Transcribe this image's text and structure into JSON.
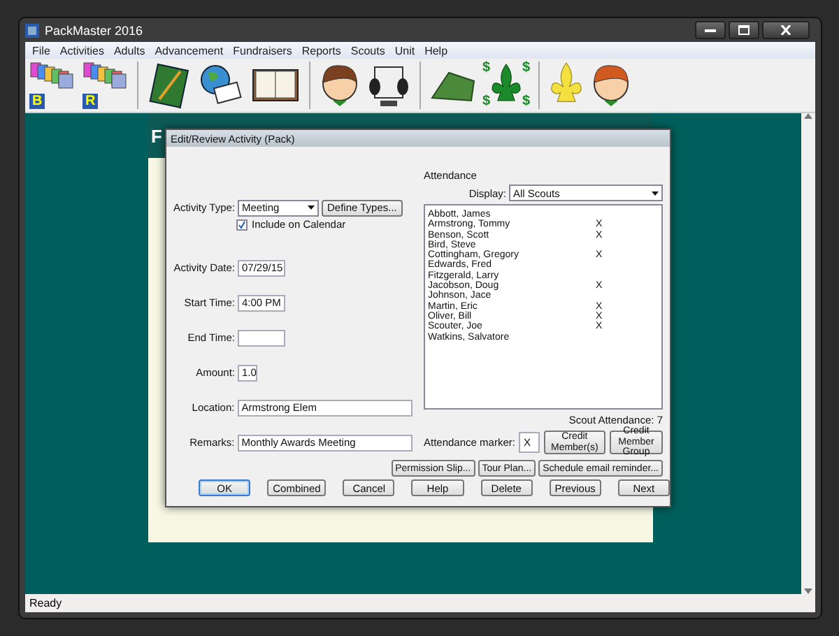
{
  "window": {
    "title": "PackMaster 2016"
  },
  "menu": [
    "File",
    "Activities",
    "Adults",
    "Advancement",
    "Fundraisers",
    "Reports",
    "Scouts",
    "Unit",
    "Help"
  ],
  "toolbar": [
    {
      "kind": "cards",
      "letter": "B"
    },
    {
      "kind": "cards",
      "letter": "R"
    },
    {
      "kind": "separator"
    },
    {
      "kind": "notebook"
    },
    {
      "kind": "globe-mail"
    },
    {
      "kind": "planner"
    },
    {
      "kind": "separator"
    },
    {
      "kind": "avatar-brown"
    },
    {
      "kind": "rolodex"
    },
    {
      "kind": "separator"
    },
    {
      "kind": "tent"
    },
    {
      "kind": "fleur-money",
      "symbol": "$"
    },
    {
      "kind": "separator"
    },
    {
      "kind": "fleur-yellow"
    },
    {
      "kind": "avatar-red"
    }
  ],
  "background_panel": {
    "heading": "F"
  },
  "dialog": {
    "title": "Edit/Review Activity  (Pack)",
    "activity_type": {
      "label": "Activity Type:",
      "value": "Meeting",
      "define_button": "Define Types..."
    },
    "include_on_calendar": {
      "label": "Include on Calendar",
      "checked": true
    },
    "fields": [
      {
        "label": "Activity Date:",
        "value": "07/29/15"
      },
      {
        "label": "Start Time:",
        "value": "4:00 PM"
      },
      {
        "label": "End Time:"
      },
      {
        "label": "Amount:",
        "value": "1.0"
      },
      {
        "label": "Location:",
        "value": "Armstrong Elem"
      },
      {
        "label": "Remarks:",
        "value": "Monthly Awards Meeting"
      }
    ],
    "attendance": {
      "title": "Attendance",
      "display_label": "Display:",
      "display_value": "All Scouts",
      "scouts": [
        {
          "name": "Abbott,  James"
        },
        {
          "name": "Armstrong,  Tommy",
          "marker": "X"
        },
        {
          "name": "Benson,  Scott",
          "marker": "X"
        },
        {
          "name": "Bird,  Steve"
        },
        {
          "name": "Cottingham,  Gregory",
          "marker": "X"
        },
        {
          "name": "Edwards,  Fred"
        },
        {
          "name": "Fitzgerald,  Larry"
        },
        {
          "name": "Jacobson,  Doug",
          "marker": "X"
        },
        {
          "name": "Johnson,  Jace"
        },
        {
          "name": "Martin,  Eric",
          "marker": "X"
        },
        {
          "name": "Oliver,  Bill",
          "marker": "X"
        },
        {
          "name": "Scouter,  Joe",
          "marker": "X"
        },
        {
          "name": "Watkins,  Salvatore"
        }
      ],
      "summary": "Scout Attendance: 7",
      "marker_label": "Attendance marker:",
      "marker_value": "X",
      "credit_buttons": [
        "Credit Member(s)",
        "Credit Member Group"
      ]
    },
    "action_buttons": [
      "Permission Slip...",
      "Tour Plan...",
      "Schedule email reminder..."
    ],
    "bottom_buttons": [
      {
        "label": "OK",
        "default": true
      },
      {
        "label": "Combined",
        "default": false
      },
      {
        "label": "Cancel",
        "default": false
      },
      {
        "label": "Help",
        "default": false
      },
      {
        "label": "Delete",
        "default": false
      },
      {
        "label": "Previous",
        "default": false
      },
      {
        "label": "Next",
        "default": false
      }
    ]
  },
  "status_bar": "Ready"
}
